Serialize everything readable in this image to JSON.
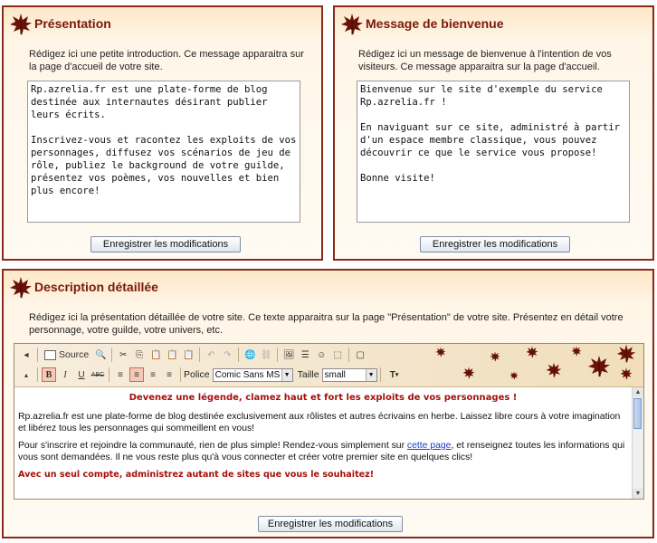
{
  "panel_presentation": {
    "title": "Présentation",
    "description": "Rédigez ici une petite introduction. Ce message apparaitra sur la page d'accueil de votre site.",
    "text": "Rp.azrelia.fr est une plate-forme de blog destinée aux internautes désirant publier leurs écrits.\n\nInscrivez-vous et racontez les exploits de vos personnages, diffusez vos scénarios de jeu de rôle, publiez le background de votre guilde, présentez vos poèmes, vos nouvelles et bien plus encore!",
    "save_label": "Enregistrer les modifications"
  },
  "panel_welcome": {
    "title": "Message de bienvenue",
    "description": "Rédigez ici un message de bienvenue à l'intention de vos visiteurs. Ce message apparaitra sur la page d'accueil.",
    "text": "Bienvenue sur le site d'exemple du service Rp.azrelia.fr !\n\nEn naviguant sur ce site, administré à partir d'un espace membre classique, vous pouvez découvrir ce que le service vous propose!\n\nBonne visite!",
    "save_label": "Enregistrer les modifications"
  },
  "panel_detailed": {
    "title": "Description détaillée",
    "description": "Rédigez ici la présentation détaillée de votre site. Ce texte apparaitra sur la page \"Présentation\" de votre site. Présentez en détail votre personnage, votre guilde, votre univers, etc.",
    "save_label": "Enregistrer les modifications",
    "toolbar": {
      "source_label": "Source",
      "font_label": "Police",
      "font_value": "Comic Sans MS",
      "size_label": "Taille",
      "size_value": "small"
    },
    "content": {
      "heading": "Devenez une légende, clamez haut et fort les exploits de vos personnages !",
      "para1": "Rp.azrelia.fr est une plate-forme de blog destinée exclusivement aux rôlistes et autres écrivains en herbe. Laissez libre cours à votre imagination et libérez tous les personnages qui sommeillent en vous!",
      "para2_before": "Pour s'inscrire et rejoindre la communauté, rien de plus simple! Rendez-vous simplement sur ",
      "para2_link": "cette page",
      "para2_after": ", et renseignez toutes les informations qui vous sont demandées. Il ne vous reste plus qu'à vous connecter et créer votre premier site en quelques clics!",
      "closing": "Avec un seul compte, administrez autant de sites que vous le souhaitez!"
    }
  },
  "colors": {
    "border": "#8a2a1a",
    "title": "#7a1a0a",
    "accent_red": "#a5100a"
  }
}
